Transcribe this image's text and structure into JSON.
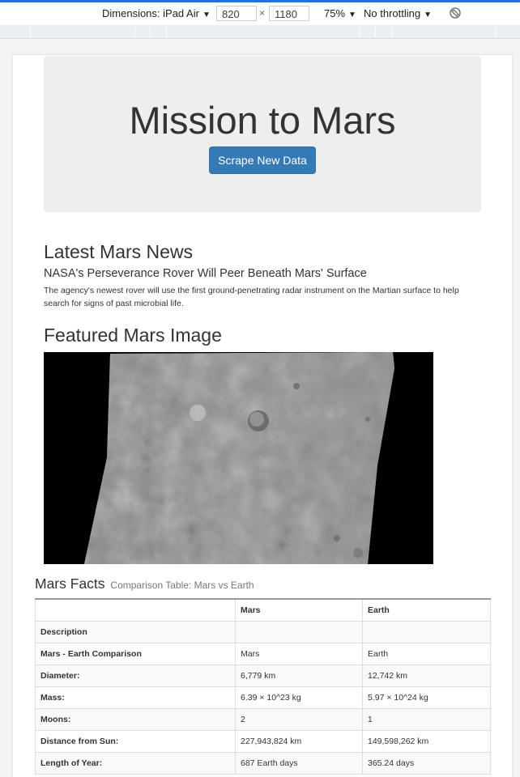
{
  "devtools": {
    "dimensions_label": "Dimensions: iPad Air",
    "width_value": "820",
    "times": "×",
    "height_value": "1180",
    "zoom": "75%",
    "throttling": "No throttling"
  },
  "page": {
    "title": "Mission to Mars",
    "scrape_button": "Scrape New Data",
    "news_heading": "Latest Mars News",
    "news_title": "NASA's Perseverance Rover Will Peer Beneath Mars' Surface",
    "news_paragraph": "The agency's newest rover will use the first ground-penetrating radar instrument on the Martian surface to help search for signs of past microbial life.",
    "featured_heading": "Featured Mars Image",
    "facts_heading": "Mars Facts",
    "facts_subheading": "Comparison Table: Mars vs Earth"
  },
  "facts_table": {
    "header": [
      "",
      "Mars",
      "Earth"
    ],
    "rows": [
      [
        "Description",
        "",
        ""
      ],
      [
        "Mars - Earth Comparison",
        "Mars",
        "Earth"
      ],
      [
        "Diameter:",
        "6,779 km",
        "12,742 km"
      ],
      [
        "Mass:",
        "6.39 × 10^23 kg",
        "5.97 × 10^24 kg"
      ],
      [
        "Moons:",
        "2",
        "1"
      ],
      [
        "Distance from Sun:",
        "227,943,824 km",
        "149,598,262 km"
      ],
      [
        "Length of Year:",
        "687 Earth days",
        "365.24 days"
      ]
    ]
  }
}
